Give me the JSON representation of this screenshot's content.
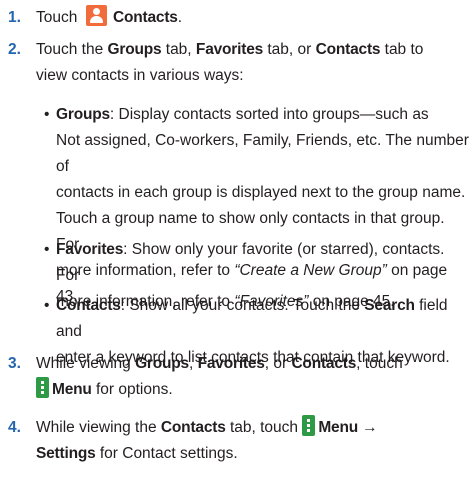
{
  "steps": [
    {
      "num": "1.",
      "touch": "Touch",
      "contacts_label": "Contacts",
      "end": "."
    },
    {
      "num": "2.",
      "l1_a": "Touch the ",
      "l1_groups": "Groups",
      "l1_b": " tab, ",
      "l1_favorites": "Favorites",
      "l1_c": " tab, or ",
      "l1_contacts": "Contacts",
      "l1_d": " tab to",
      "l2": "view contacts in various ways:",
      "bullets": [
        {
          "dot": "•",
          "term": "Groups",
          "lines": [
            ": Display contacts sorted into groups—such as",
            "Not assigned, Co-workers, Family, Friends, etc. The number of",
            "contacts in each group is displayed next to the group name.",
            "Touch a group name to show only contacts in that group. For"
          ],
          "last_a": "more information, refer to ",
          "last_ref": "“Create a New Group”",
          "last_b": " on page 43."
        },
        {
          "dot": "•",
          "term": "Favorites",
          "l1": ": Show only your favorite (or starred), contacts. For",
          "l2_a": "more information, refer to ",
          "l2_ref": "“Favorites”",
          "l2_b": " on page 45."
        },
        {
          "dot": "•",
          "term": "Contacts",
          "l1_a": ": Show all your contacts. Touch the ",
          "l1_search": "Search",
          "l1_b": " field and",
          "l2": "enter a keyword to list contacts that contain that keyword."
        }
      ]
    },
    {
      "num": "3.",
      "l1_a": "While viewing ",
      "l1_groups": "Groups",
      "l1_b": ", ",
      "l1_favorites": "Favorites",
      "l1_c": ", or ",
      "l1_contacts": "Contacts",
      "l1_d": ", touch",
      "menu_label": "Menu",
      "l2_b": " for options."
    },
    {
      "num": "4.",
      "l1_a": "While viewing the ",
      "l1_contacts": "Contacts",
      "l1_b": " tab, touch",
      "menu_label": "Menu",
      "arrow": " →",
      "settings_label": "Settings",
      "l2_b": " for Contact settings."
    }
  ],
  "icons": {
    "contacts_icon": "contacts-person-icon",
    "menu_icon": "menu-dots-icon",
    "contacts_color": "#f26b3a",
    "menu_color": "#2f9a46",
    "number_color": "#2565ad"
  }
}
